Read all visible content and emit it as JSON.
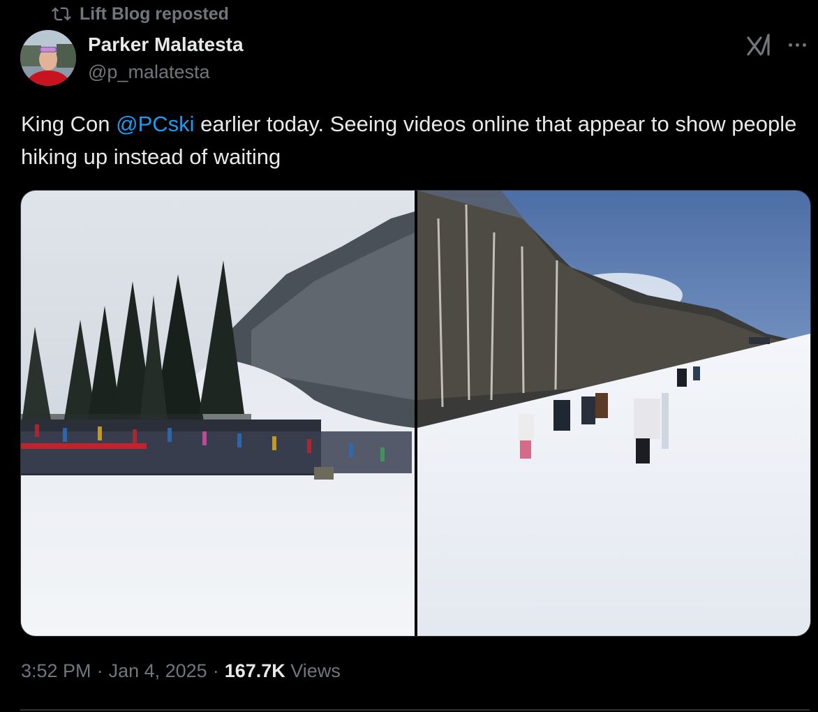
{
  "repost": {
    "label": "Lift Blog reposted",
    "icon": "repost-icon"
  },
  "author": {
    "name": "Parker Malatesta",
    "handle": "@p_malatesta",
    "avatar_icon": "avatar"
  },
  "header_icons": {
    "grok": "grok-icon",
    "more": "more-icon"
  },
  "tweet": {
    "text_before": "King Con ",
    "mention": "@PCski",
    "text_after": " earlier today. Seeing videos online that appear to show people hiking up instead of waiting"
  },
  "media": {
    "photos": [
      {
        "subject": "crowded lift line"
      },
      {
        "subject": "people hiking up slope"
      }
    ]
  },
  "meta": {
    "time": "3:52 PM",
    "sep1": "·",
    "date": "Jan 4, 2025",
    "sep2": "·",
    "views_count": "167.7K",
    "views_label": "Views"
  },
  "colors": {
    "accent": "#1d9bf0",
    "muted": "#71767b",
    "text": "#e7e9ea",
    "bg": "#000000"
  }
}
